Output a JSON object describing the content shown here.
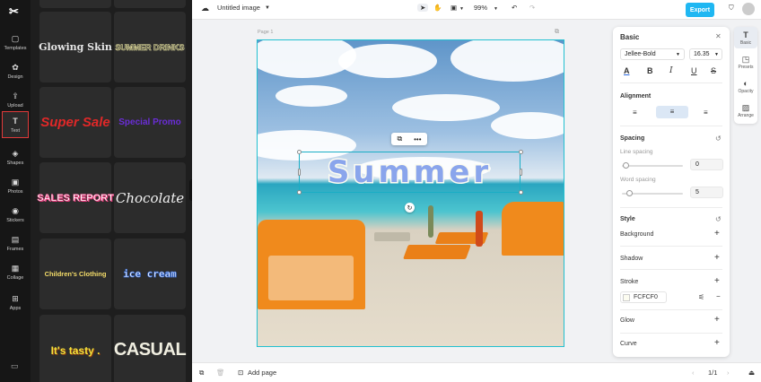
{
  "app": {
    "logo": "✂"
  },
  "rail": {
    "items": [
      {
        "label": "Templates",
        "icon": "▢"
      },
      {
        "label": "Design",
        "icon": "✿"
      },
      {
        "label": "Upload",
        "icon": "⇪"
      },
      {
        "label": "Text",
        "icon": "T"
      },
      {
        "label": "Shapes",
        "icon": "◈"
      },
      {
        "label": "Photos",
        "icon": "▣"
      },
      {
        "label": "Stickers",
        "icon": "◉"
      },
      {
        "label": "Frames",
        "icon": "▤"
      },
      {
        "label": "Collage",
        "icon": "▦"
      },
      {
        "label": "Apps",
        "icon": "⊞"
      }
    ],
    "settings_icon": "▭"
  },
  "text_styles": [
    {
      "label": "Glowing Skin"
    },
    {
      "label": "SUMMER DRINKS"
    },
    {
      "label": "Super Sale"
    },
    {
      "label": "Special Promo"
    },
    {
      "label": "SALES REPORT"
    },
    {
      "label": "Chocolate"
    },
    {
      "label": "Children's Clothing"
    },
    {
      "label": "ice cream"
    },
    {
      "label": "It's tasty ."
    },
    {
      "label": "CASUAL"
    }
  ],
  "topbar": {
    "title": "Untitled image",
    "zoom": "99%",
    "export": "Export"
  },
  "canvas": {
    "page_label": "Page 1",
    "text": "Summer"
  },
  "bottombar": {
    "add_page": "Add page",
    "pagination": "1/1"
  },
  "props": {
    "title": "Basic",
    "font": "Jellee-Bold",
    "size": "16.35",
    "alignment": "Alignment",
    "spacing": "Spacing",
    "line_spacing": "Line spacing",
    "line_spacing_value": "0",
    "word_spacing": "Word spacing",
    "word_spacing_value": "5",
    "style": "Style",
    "background": "Background",
    "shadow": "Shadow",
    "stroke": "Stroke",
    "stroke_color": "FCFCF0",
    "glow": "Glow",
    "curve": "Curve"
  },
  "sidetools": [
    {
      "label": "Basic",
      "icon": "T"
    },
    {
      "label": "Presets",
      "icon": "◳"
    },
    {
      "label": "Opacity",
      "icon": "◐"
    },
    {
      "label": "Arrange",
      "icon": "▨"
    }
  ],
  "colors": {
    "accent": "#1fb7f2",
    "text_fill": "#8aa5ec",
    "text_stroke": "#fcfcf0"
  }
}
